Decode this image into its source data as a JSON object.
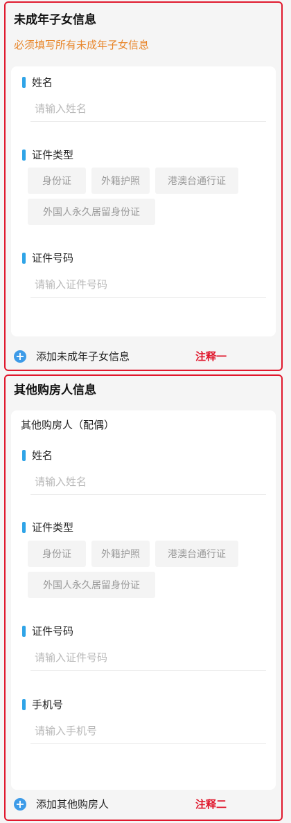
{
  "minor_children": {
    "title": "未成年子女信息",
    "required_note": "必须填写所有未成年子女信息",
    "name_label": "姓名",
    "name_placeholder": "请输入姓名",
    "id_type_label": "证件类型",
    "id_types": [
      "身份证",
      "外籍护照",
      "港澳台通行证",
      "外国人永久居留身份证"
    ],
    "id_number_label": "证件号码",
    "id_number_placeholder": "请输入证件号码",
    "add_label": "添加未成年子女信息",
    "annotation": "注释一"
  },
  "other_buyers": {
    "title": "其他购房人信息",
    "subtitle": "其他购房人（配偶）",
    "name_label": "姓名",
    "name_placeholder": "请输入姓名",
    "id_type_label": "证件类型",
    "id_types": [
      "身份证",
      "外籍护照",
      "港澳台通行证",
      "外国人永久居留身份证"
    ],
    "id_number_label": "证件号码",
    "id_number_placeholder": "请输入证件号码",
    "phone_label": "手机号",
    "phone_placeholder": "请输入手机号",
    "add_label": "添加其他购房人",
    "annotation": "注释二"
  },
  "icons": {
    "add": "plus-circle-icon"
  },
  "colors": {
    "accent": "#3d9be8",
    "annotation_red": "#e0182d",
    "warning_orange": "#e8862b"
  }
}
